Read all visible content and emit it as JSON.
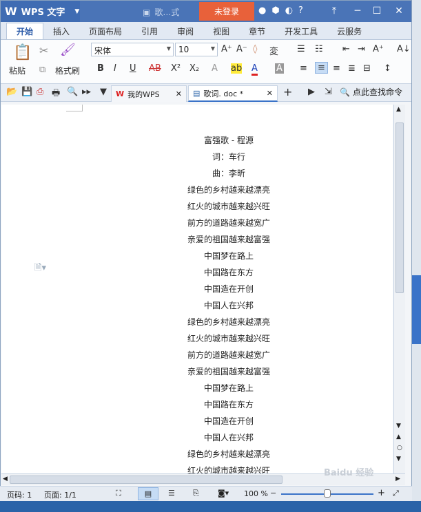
{
  "app": {
    "name": "WPS 文字",
    "logo_letter": "W"
  },
  "title_doc": "歌…式",
  "login_label": "未登录",
  "ribbon_tabs": [
    "开始",
    "插入",
    "页面布局",
    "引用",
    "审阅",
    "视图",
    "章节",
    "开发工具",
    "云服务"
  ],
  "ribbon": {
    "paste_label": "粘贴",
    "format_painter_label": "格式刷",
    "font_name": "宋体",
    "font_size": "10"
  },
  "doc_tabs": [
    {
      "label": "我的WPS"
    },
    {
      "label": "歌词. doc *"
    }
  ],
  "search_label": "点此查找命令",
  "lyrics": [
    "富强歌 - 程源",
    "词：车行",
    "曲：李昕",
    "绿色的乡村越来越漂亮",
    "红火的城市越来越兴旺",
    "前方的道路越来越宽广",
    "亲爱的祖国越来越富强",
    "中国梦在路上",
    "中国路在东方",
    "中国造在开创",
    "中国人在兴邦",
    "绿色的乡村越来越漂亮",
    "红火的城市越来越兴旺",
    "前方的道路越来越宽广",
    "亲爱的祖国越来越富强",
    "中国梦在路上",
    "中国路在东方",
    "中国造在开创",
    "中国人在兴邦",
    "绿色的乡村越来越漂亮",
    "红火的城市越来越兴旺"
  ],
  "status": {
    "page_label": "页码: 1",
    "pages_label": "页面: 1/1",
    "zoom": "100 %"
  },
  "watermark": "Baidu 经验"
}
